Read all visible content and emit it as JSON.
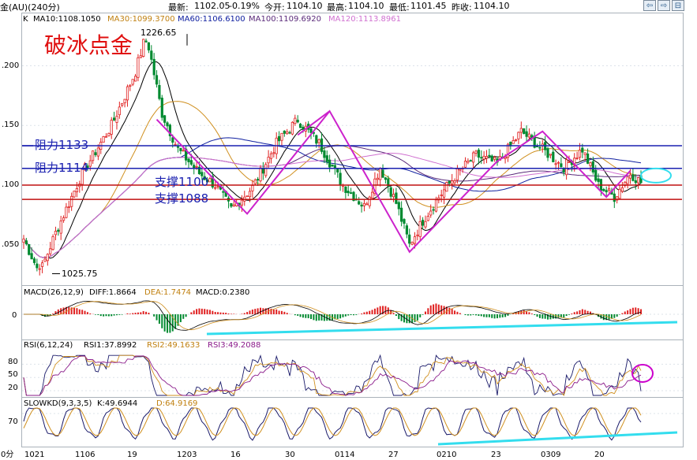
{
  "header": {
    "instrument": "金(AU)(240分)",
    "latest_label": "最新:",
    "latest": "1102.05",
    "change": "-0.19%",
    "open_label": "今开:",
    "open": "1104.10",
    "high_label": "最高:",
    "high": "1104.10",
    "low_label": "最低:",
    "low": "1101.45",
    "prevclose_label": "昨收:",
    "prevclose": "1104.10"
  },
  "buttons": [
    "⇦",
    "⇨",
    "⊟"
  ],
  "ma_legend": {
    "k": "K",
    "ma10": "MA10:1108.1050",
    "ma30": "MA30:1099.3700",
    "ma60": "MA60:1106.6100",
    "ma100": "MA100:1109.6920",
    "ma120": "MA120:1113.8961"
  },
  "annotations": {
    "title": "破冰点金",
    "res1": "阻力1133",
    "res2": "阻力1114",
    "sup1": "支撑1100",
    "sup2": "支撑1088",
    "high_label": "1226.65",
    "low_label": "1025.75"
  },
  "macd_legend": {
    "name": "MACD(26,12,9)",
    "diff": "DIFF:1.8664",
    "dea": "DEA:1.7474",
    "macd": "MACD:0.2380"
  },
  "rsi_legend": {
    "name": "RSI(6,12,24)",
    "rsi1": "RSI1:37.8992",
    "rsi2": "RSI2:49.1633",
    "rsi3": "RSI3:49.2088"
  },
  "kd_legend": {
    "name": "SLOWKD(9,3,3,5)",
    "k": "K:49.6944",
    "d": "D:64.9169"
  },
  "y_axis": {
    "main": [
      ".200",
      ".150",
      ".100",
      ".050"
    ],
    "macd": [
      "0"
    ],
    "rsi": [
      "80",
      "50",
      "20"
    ],
    "kd": [
      "70"
    ]
  },
  "x_axis": [
    "1021",
    "1106",
    "19",
    "1203",
    "16",
    "30",
    "0114",
    "27",
    "0210",
    "23",
    "0309",
    "20"
  ],
  "bottom_left": "0分",
  "colors": {
    "up": "#e02020",
    "down": "#008a30",
    "res": "#1a20b0",
    "sup": "#c01010",
    "zigzag": "#cc22cc",
    "trend": "#33ddee",
    "title": "#e01010",
    "ma10": "#000000",
    "ma30": "#d09020",
    "ma60": "#1020a0",
    "ma100": "#5a2a7a",
    "ma120": "#d070d0"
  },
  "chart_data": [
    {
      "type": "candlestick",
      "title": "破冰点金",
      "resistance": [
        1133,
        1114
      ],
      "support": [
        1100,
        1088
      ],
      "annotated_high": 1226.65,
      "annotated_low": 1025.75,
      "pivots": [
        {
          "bar": 0,
          "price": 1055
        },
        {
          "bar": 6,
          "price": 1025.75
        },
        {
          "bar": 12,
          "price": 1060
        },
        {
          "bar": 22,
          "price": 1110
        },
        {
          "bar": 33,
          "price": 1150
        },
        {
          "bar": 42,
          "price": 1195
        },
        {
          "bar": 46,
          "price": 1226.65
        },
        {
          "bar": 52,
          "price": 1160
        },
        {
          "bar": 58,
          "price": 1130
        },
        {
          "bar": 66,
          "price": 1110
        },
        {
          "bar": 72,
          "price": 1100
        },
        {
          "bar": 78,
          "price": 1080
        },
        {
          "bar": 86,
          "price": 1098
        },
        {
          "bar": 95,
          "price": 1135
        },
        {
          "bar": 103,
          "price": 1155
        },
        {
          "bar": 111,
          "price": 1135
        },
        {
          "bar": 120,
          "price": 1100
        },
        {
          "bar": 128,
          "price": 1082
        },
        {
          "bar": 134,
          "price": 1115
        },
        {
          "bar": 140,
          "price": 1085
        },
        {
          "bar": 145,
          "price": 1050
        },
        {
          "bar": 150,
          "price": 1070
        },
        {
          "bar": 156,
          "price": 1090
        },
        {
          "bar": 163,
          "price": 1110
        },
        {
          "bar": 170,
          "price": 1125
        },
        {
          "bar": 178,
          "price": 1118
        },
        {
          "bar": 187,
          "price": 1145
        },
        {
          "bar": 195,
          "price": 1130
        },
        {
          "bar": 203,
          "price": 1115
        },
        {
          "bar": 210,
          "price": 1130
        },
        {
          "bar": 216,
          "price": 1100
        },
        {
          "bar": 222,
          "price": 1090
        },
        {
          "bar": 228,
          "price": 1110
        },
        {
          "bar": 232,
          "price": 1102.05
        }
      ],
      "bars": 233
    }
  ]
}
